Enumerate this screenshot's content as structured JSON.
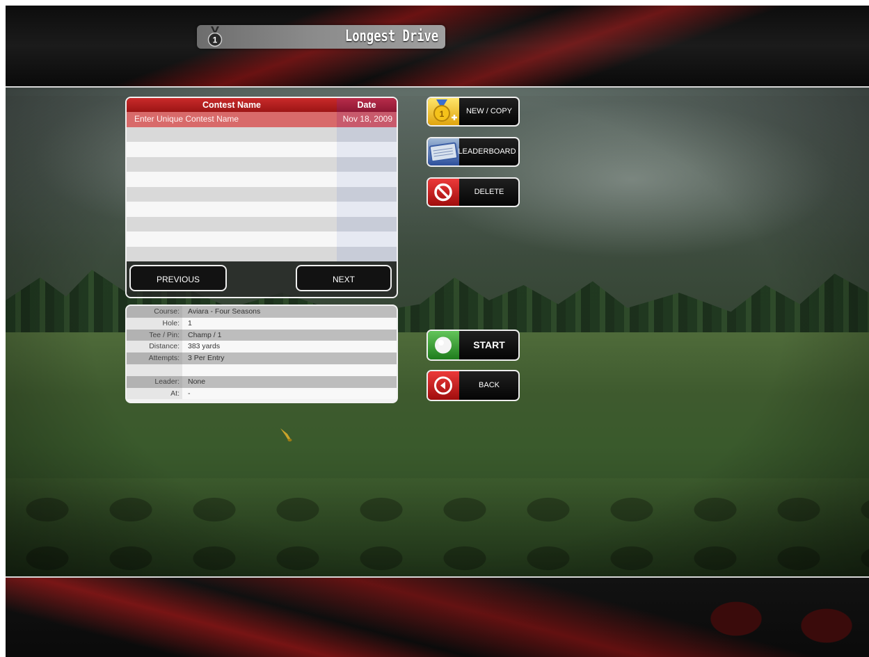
{
  "header": {
    "title": "Longest Drive",
    "medal_number": "1"
  },
  "contest_table": {
    "columns": [
      "Contest Name",
      "Date"
    ],
    "rows": [
      {
        "name": "Enter Unique Contest Name",
        "date": "Nov 18, 2009",
        "selected": true
      },
      {
        "name": "",
        "date": ""
      },
      {
        "name": "",
        "date": ""
      },
      {
        "name": "",
        "date": ""
      },
      {
        "name": "",
        "date": ""
      },
      {
        "name": "",
        "date": ""
      },
      {
        "name": "",
        "date": ""
      },
      {
        "name": "",
        "date": ""
      },
      {
        "name": "",
        "date": ""
      },
      {
        "name": "",
        "date": ""
      }
    ],
    "previous_label": "PREVIOUS",
    "next_label": "NEXT"
  },
  "details": [
    {
      "key": "Course:",
      "value": "Aviara - Four Seasons"
    },
    {
      "key": "Hole:",
      "value": "1"
    },
    {
      "key": "Tee / Pin:",
      "value": "Champ / 1"
    },
    {
      "key": "Distance:",
      "value": "383 yards"
    },
    {
      "key": "Attempts:",
      "value": "3 Per Entry"
    },
    {
      "key": "",
      "value": ""
    },
    {
      "key": "Leader:",
      "value": "None"
    },
    {
      "key": "At:",
      "value": "-"
    }
  ],
  "actions": {
    "new_copy": {
      "label": "NEW / COPY",
      "icon": "medal-plus-icon"
    },
    "leaderboard": {
      "label": "LEADERBOARD",
      "icon": "leaderboard-icon"
    },
    "delete": {
      "label": "DELETE",
      "icon": "no-symbol-icon"
    },
    "start": {
      "label": "START",
      "icon": "golf-ball-icon"
    },
    "back": {
      "label": "BACK",
      "icon": "back-arrow-icon"
    }
  },
  "colors": {
    "header_red": "#c92a2a",
    "selected_row": "#d86a6a",
    "start_green": "#3fa33a",
    "delete_red": "#d01e1e"
  }
}
